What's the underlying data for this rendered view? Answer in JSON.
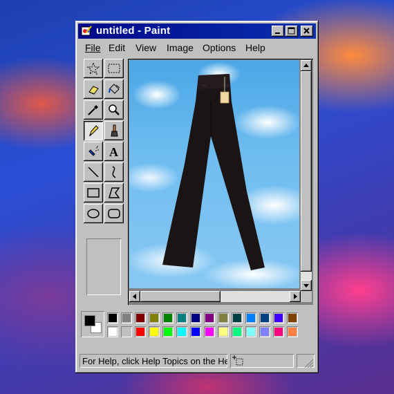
{
  "window": {
    "title": "untitled - Paint",
    "title_color": "#000a8a"
  },
  "menu": [
    {
      "label": "File",
      "hotkey_index": 0
    },
    {
      "label": "Edit",
      "hotkey_index": 0
    },
    {
      "label": "View",
      "hotkey_index": 0
    },
    {
      "label": "Image",
      "hotkey_index": 0
    },
    {
      "label": "Options",
      "hotkey_index": 0
    },
    {
      "label": "Help",
      "hotkey_index": 0
    }
  ],
  "tools": [
    {
      "name": "free-form-select",
      "icon": "star-select-icon"
    },
    {
      "name": "rectangle-select",
      "icon": "rect-select-icon"
    },
    {
      "name": "eraser",
      "icon": "eraser-icon"
    },
    {
      "name": "fill-with-color",
      "icon": "paint-bucket-icon"
    },
    {
      "name": "pick-color",
      "icon": "eyedropper-icon"
    },
    {
      "name": "magnifier",
      "icon": "magnifier-icon"
    },
    {
      "name": "pencil",
      "icon": "pencil-icon",
      "selected": true
    },
    {
      "name": "brush",
      "icon": "brush-icon"
    },
    {
      "name": "airbrush",
      "icon": "airbrush-icon"
    },
    {
      "name": "text",
      "icon": "text-icon",
      "glyph": "A"
    },
    {
      "name": "line",
      "icon": "line-icon"
    },
    {
      "name": "curve",
      "icon": "curve-icon"
    },
    {
      "name": "rectangle",
      "icon": "rectangle-icon"
    },
    {
      "name": "polygon",
      "icon": "polygon-icon"
    },
    {
      "name": "ellipse",
      "icon": "ellipse-icon"
    },
    {
      "name": "rounded-rectangle",
      "icon": "rounded-rectangle-icon"
    }
  ],
  "canvas": {
    "image_subject": "black-trousers-on-sky",
    "tag_color": "#f0d9a0"
  },
  "colors": {
    "foreground": "#000000",
    "background": "#ffffff",
    "palette_row1": [
      "#000000",
      "#808080",
      "#800000",
      "#808000",
      "#008000",
      "#008080",
      "#000080",
      "#800080",
      "#808040",
      "#004040",
      "#0080ff",
      "#004080",
      "#4000ff",
      "#804000"
    ],
    "palette_row2": [
      "#ffffff",
      "#c0c0c0",
      "#ff0000",
      "#ffff00",
      "#00ff00",
      "#00ffff",
      "#0000ff",
      "#ff00ff",
      "#ffff80",
      "#00ff80",
      "#80ffff",
      "#8080ff",
      "#ff0080",
      "#ff8040"
    ]
  },
  "status": {
    "help_text": "For Help, click Help Topics on the Help Menu."
  }
}
